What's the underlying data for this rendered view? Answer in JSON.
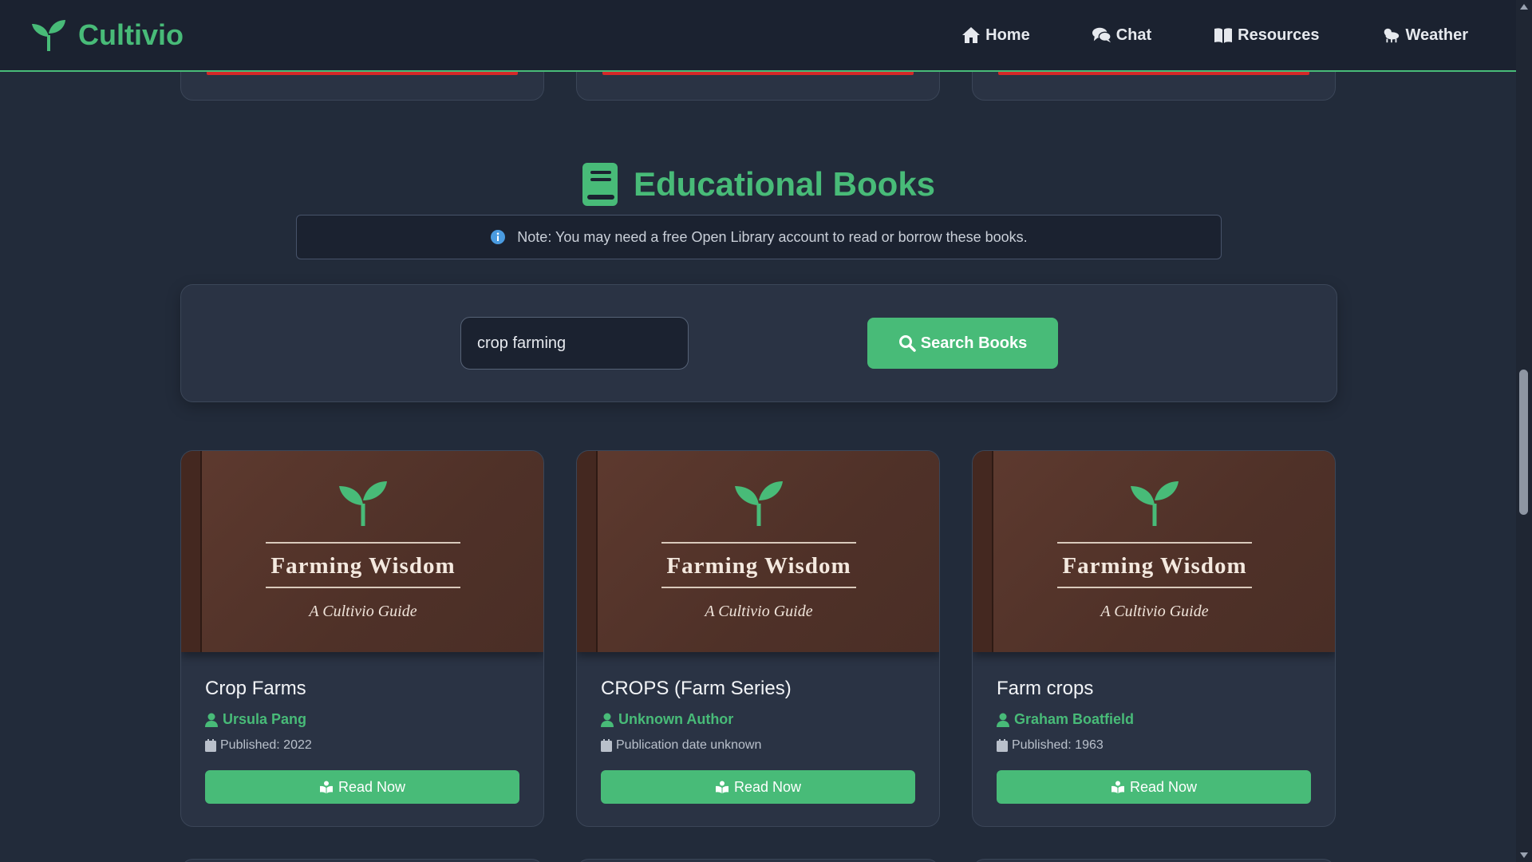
{
  "brand": {
    "name": "Cultivio",
    "logo_icon": "sprout-icon",
    "accent": "#48bb78"
  },
  "nav": {
    "items": [
      {
        "label": "Home",
        "icon": "home-icon"
      },
      {
        "label": "Chat",
        "icon": "chat-icon"
      },
      {
        "label": "Resources",
        "icon": "book-open-icon"
      },
      {
        "label": "Weather",
        "icon": "weather-icon"
      }
    ]
  },
  "section": {
    "title": "Educational Books",
    "icon": "book-icon",
    "note": "Note: You may need a free Open Library account to read or borrow these books."
  },
  "search": {
    "value": "crop farming",
    "button_label": "Search Books"
  },
  "cover": {
    "title": "Farming Wisdom",
    "subtitle": "A Cultivio Guide"
  },
  "books": [
    {
      "title": "Crop Farms",
      "author": "Ursula Pang",
      "published": "Published: 2022",
      "button_label": "Read Now"
    },
    {
      "title": "CROPS (Farm Series)",
      "author": "Unknown Author",
      "published": "Publication date unknown",
      "button_label": "Read Now"
    },
    {
      "title": "Farm crops",
      "author": "Graham Boatfield",
      "published": "Published: 1963",
      "button_label": "Read Now"
    }
  ],
  "colors": {
    "background": "#222b3a",
    "navbar": "#1b2230",
    "card": "#2a3344",
    "accent_green": "#48bb78",
    "cover_brown": "#553429",
    "alert_red": "#d62828"
  }
}
